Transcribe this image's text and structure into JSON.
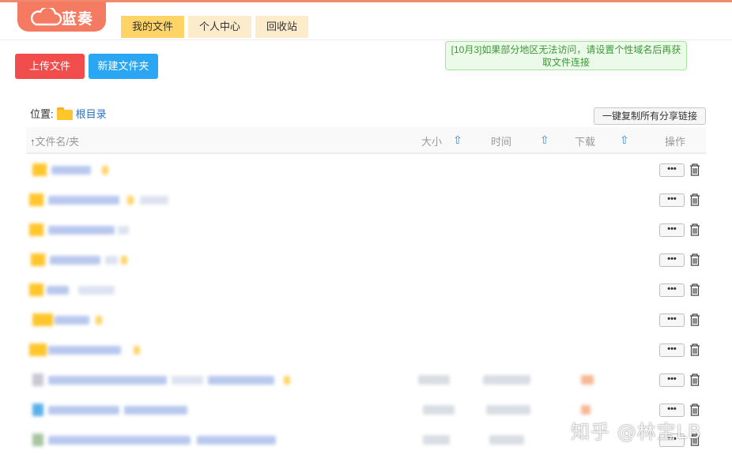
{
  "app": {
    "logo_text": "蓝奏",
    "accent_color": "#f47a62"
  },
  "tabs": [
    {
      "label": "我的文件",
      "active": true
    },
    {
      "label": "个人中心",
      "active": false
    },
    {
      "label": "回收站",
      "active": false
    }
  ],
  "notice": {
    "line1": "[10月3]如果部分地区无法访问，请设置个性域名后再获",
    "line2": "取文件连接"
  },
  "toolbar": {
    "upload_label": "上传文件",
    "new_folder_label": "新建文件夹"
  },
  "location": {
    "label": "位置:",
    "root_label": "根目录",
    "copy_all_label": "一键复制所有分享链接"
  },
  "table": {
    "headers": {
      "name": "文件名/夹",
      "name_sort_arrow": "↑",
      "size": "大小",
      "time": "时间",
      "downloads": "下载",
      "operation": "操作"
    },
    "sort_icon": "⇧",
    "rows": [
      {
        "type": "folder"
      },
      {
        "type": "folder"
      },
      {
        "type": "folder"
      },
      {
        "type": "folder"
      },
      {
        "type": "folder"
      },
      {
        "type": "folder"
      },
      {
        "type": "folder"
      },
      {
        "type": "file"
      },
      {
        "type": "file"
      },
      {
        "type": "file"
      }
    ],
    "more_label": "•••"
  },
  "watermark": "知乎 @林宝LB"
}
